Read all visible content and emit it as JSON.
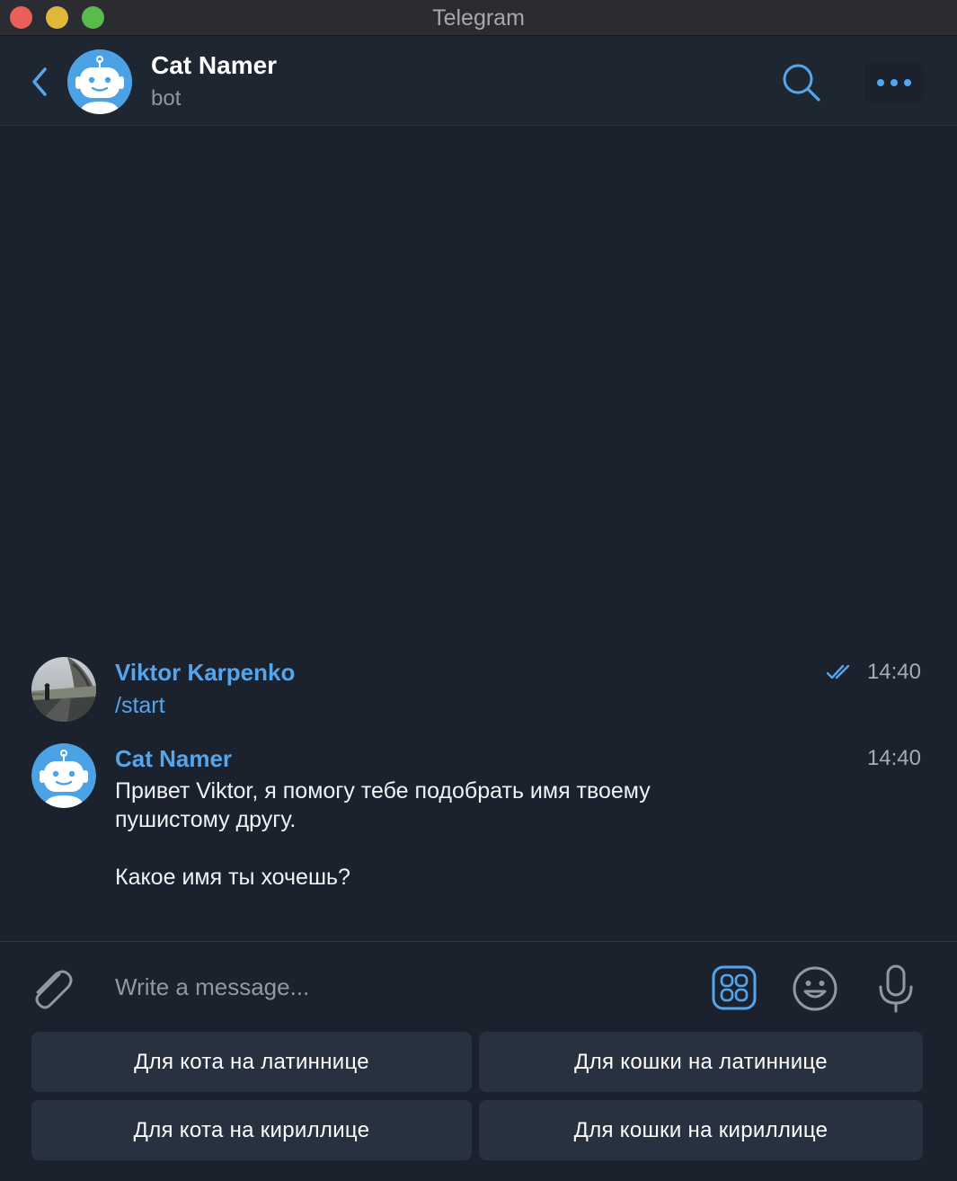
{
  "window": {
    "title": "Telegram"
  },
  "header": {
    "title": "Cat Namer",
    "subtitle": "bot"
  },
  "messages": [
    {
      "sender": "Viktor Karpenko",
      "text": "/start",
      "time": "14:40",
      "read": true
    },
    {
      "sender": "Cat Namer",
      "text": "Привет Viktor, я помогу тебе подобрать имя твоему\nпушистому другу.\n\nКакое имя ты хочешь?",
      "time": "14:40"
    }
  ],
  "composer": {
    "placeholder": "Write a message..."
  },
  "keyboard": {
    "buttons": [
      "Для кота на латиннице",
      "Для кошки на латиннице",
      "Для кота на кириллице",
      "Для кошки на кириллице"
    ]
  },
  "colors": {
    "background": "#1b222e",
    "header": "#1e2632",
    "accent": "#55a5ec",
    "button": "#283140",
    "bot_avatar": "#4ba3e6"
  },
  "icons": [
    "back-icon",
    "search-icon",
    "more-icon",
    "double-check-icon",
    "attach-icon",
    "bot-keyboard-icon",
    "emoji-icon",
    "microphone-icon"
  ]
}
